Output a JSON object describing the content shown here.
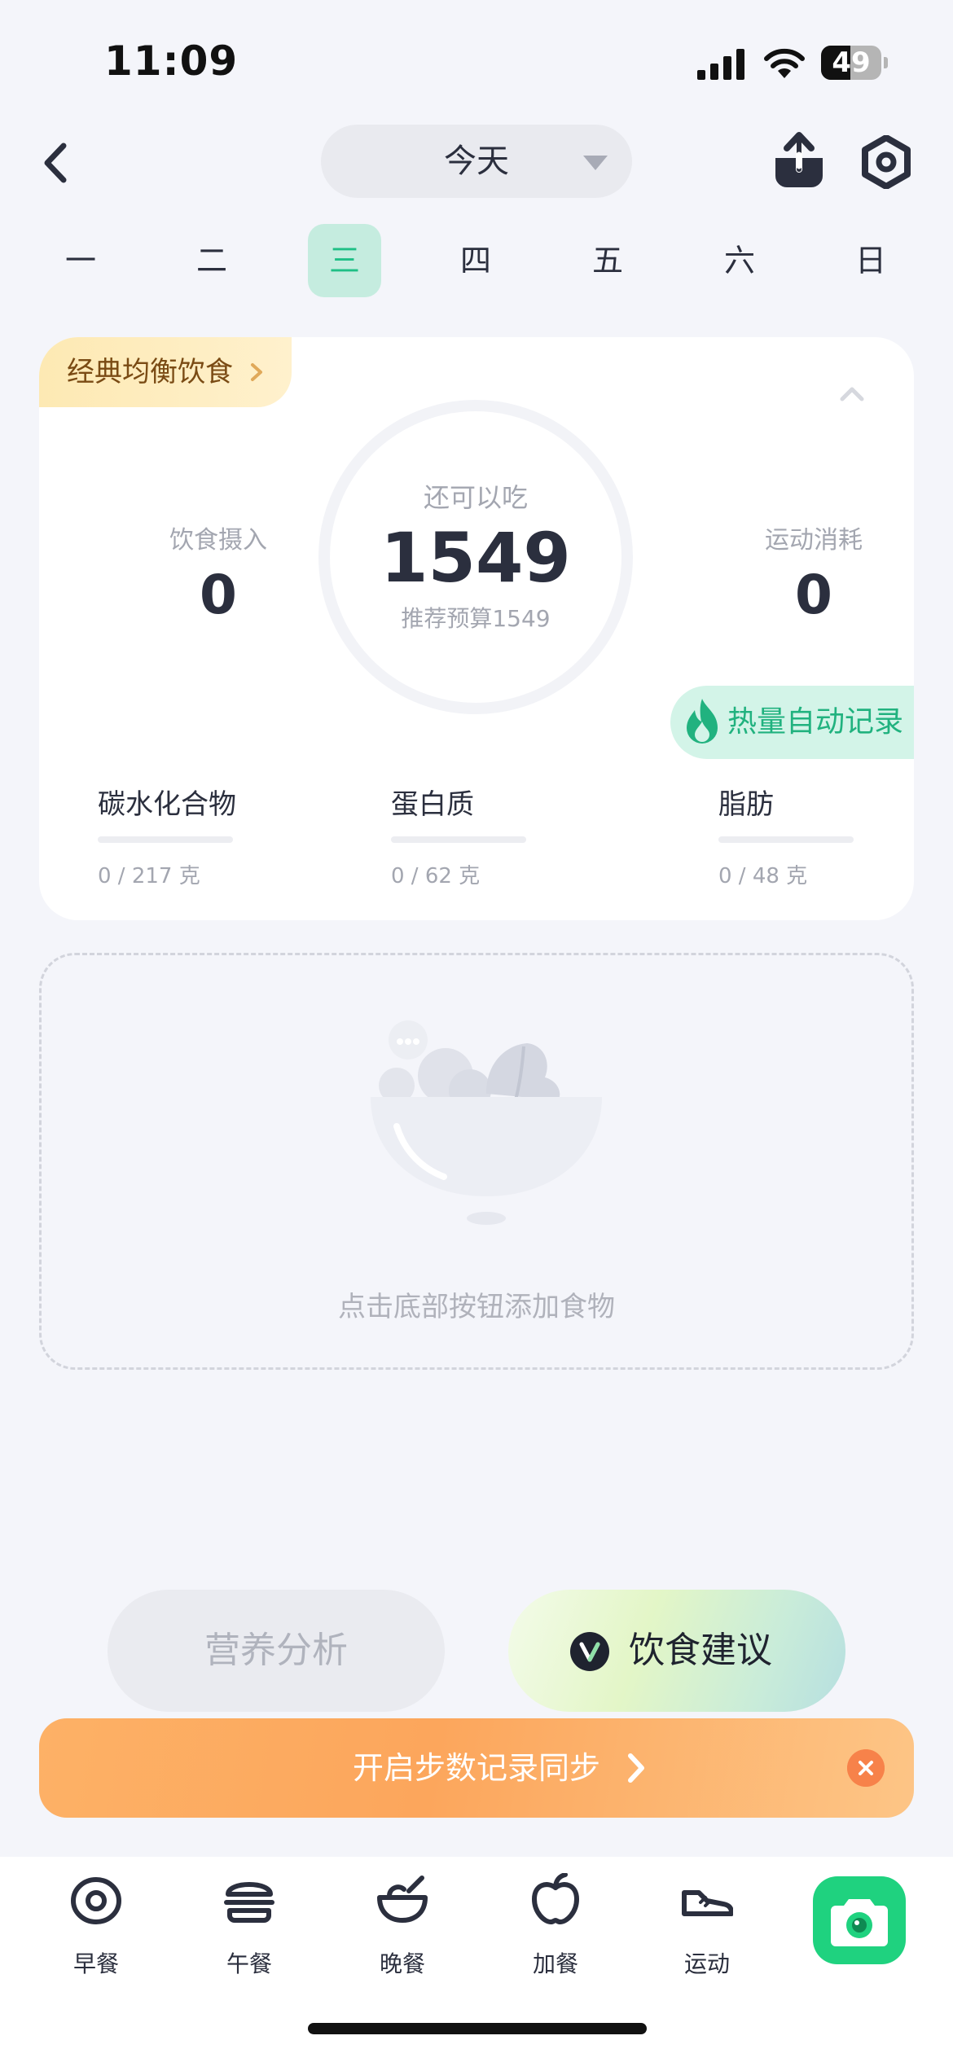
{
  "status_bar": {
    "time": "11:09",
    "battery": "49",
    "battery_level": 0.49
  },
  "header": {
    "date_select": "今天"
  },
  "weekdays": {
    "days": [
      "一",
      "二",
      "三",
      "四",
      "五",
      "六",
      "日"
    ],
    "active_index": 2
  },
  "summary": {
    "diet_plan": "经典均衡饮食",
    "remaining_caption": "还可以吃",
    "remaining_value": "1549",
    "budget_text": "推荐预算1549",
    "intake_caption": "饮食摄入",
    "intake_value": "0",
    "exercise_caption": "运动消耗",
    "exercise_value": "0",
    "auto_record_label": "热量自动记录"
  },
  "macros": [
    {
      "name": "碳水化合物",
      "amount": "0 / 217 克",
      "progress": 0
    },
    {
      "name": "蛋白质",
      "amount": "0 / 62 克",
      "progress": 0
    },
    {
      "name": "脂肪",
      "amount": "0 / 48 克",
      "progress": 0
    }
  ],
  "empty_state": {
    "text": "点击底部按钮添加食物"
  },
  "actions": {
    "analysis_label": "营养分析",
    "advice_label": "饮食建议"
  },
  "sync_banner": {
    "label": "开启步数记录同步"
  },
  "tab_bar": {
    "breakfast": "早餐",
    "lunch": "午餐",
    "dinner": "晚餐",
    "snack": "加餐",
    "exercise": "运动"
  },
  "colors": {
    "accent": "#1fbf86",
    "camera": "#1fd27f",
    "banner": "#fca65c",
    "badge": "#fde9b3"
  }
}
